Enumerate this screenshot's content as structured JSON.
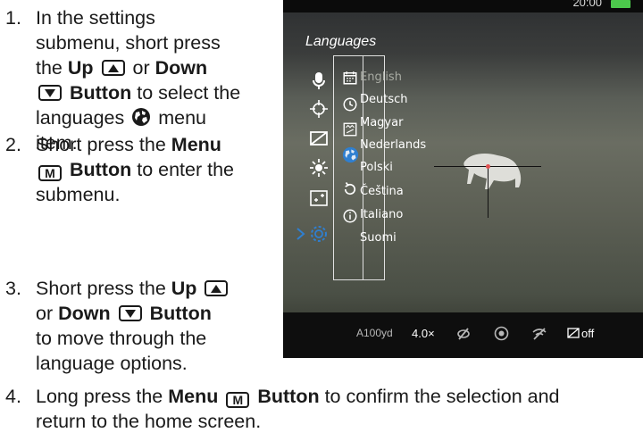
{
  "steps": [
    {
      "number": "1.",
      "lines": [
        "In the settings",
        "submenu, short press",
        "the",
        "Up",
        "or",
        "Down",
        "Button",
        "to select the",
        "languages",
        "menu",
        "item."
      ]
    },
    {
      "number": "2.",
      "lines": [
        "Short press the",
        "Menu",
        "M",
        "Button",
        "to enter the",
        "submenu."
      ]
    },
    {
      "number": "3.",
      "lines": [
        "Short press the",
        "Up",
        "or",
        "Down",
        "Button",
        "to move through the",
        "language options."
      ]
    },
    {
      "number": "4.",
      "lines": [
        "Long press the",
        "Menu",
        "M",
        "Button",
        "to confirm the selection and",
        "return to the home screen."
      ]
    }
  ],
  "device": {
    "clock": "20:00",
    "menu_title": "Languages",
    "languages": [
      "English",
      "Deutsch",
      "Magyar",
      "Nederlands",
      "Polski",
      "Čeština",
      "Italiano",
      "Suomi"
    ],
    "selected_language": "English",
    "left_icons": [
      "microphone-icon",
      "crosshair-icon",
      "display-off-icon",
      "brightness-icon",
      "zoom-box-icon",
      "settings-icon"
    ],
    "sub_icons": [
      "calendar-icon",
      "clock-icon",
      "units-icon",
      "globe-icon",
      "reset-icon",
      "info-icon"
    ],
    "status_bar": {
      "range": "A100yd",
      "zoom": "4.0×",
      "display_off": "off"
    },
    "colors": {
      "battery": "#4cc94c",
      "accent": "#2f7fd0"
    }
  }
}
